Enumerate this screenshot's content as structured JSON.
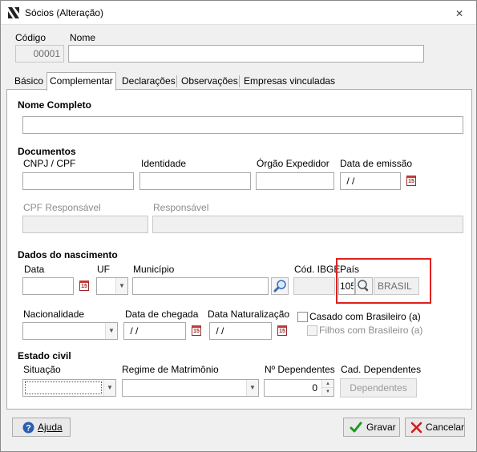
{
  "window": {
    "title": "Sócios (Alteração)"
  },
  "header": {
    "codigo_label": "Código",
    "codigo_value": "00001",
    "nome_label": "Nome",
    "nome_value": ""
  },
  "tabs": [
    {
      "label": "Básico",
      "active": false
    },
    {
      "label": "Complementar",
      "active": true
    },
    {
      "label": "Declarações",
      "active": false
    },
    {
      "label": "Observações",
      "active": false
    },
    {
      "label": "Empresas vinculadas",
      "active": false
    }
  ],
  "nome_completo": {
    "section": "Nome Completo",
    "value": ""
  },
  "documentos": {
    "section": "Documentos",
    "cnpj_label": "CNPJ / CPF",
    "cnpj_value": "",
    "identidade_label": "Identidade",
    "identidade_value": "",
    "orgao_label": "Órgão Expedidor",
    "orgao_value": "",
    "data_emissao_label": "Data de emissão",
    "data_emissao_value": " / /",
    "cpf_resp_label": "CPF Responsável",
    "cpf_resp_value": "",
    "responsavel_label": "Responsável",
    "responsavel_value": ""
  },
  "nascimento": {
    "section": "Dados do nascimento",
    "data_label": "Data",
    "data_value": "",
    "uf_label": "UF",
    "uf_value": "",
    "municipio_label": "Município",
    "municipio_value": "",
    "cod_ibge_label": "Cód. IBGE",
    "cod_ibge_value": "",
    "pais_label": "País",
    "pais_code": "105",
    "pais_name": "BRASIL",
    "nacionalidade_label": "Nacionalidade",
    "nacionalidade_value": "",
    "data_chegada_label": "Data de chegada",
    "data_chegada_value": " / /",
    "data_natur_label": "Data Naturalização",
    "data_natur_value": " / /",
    "casado_label": "Casado com Brasileiro (a)",
    "filhos_label": "Filhos com Brasileiro (a)"
  },
  "estado_civil": {
    "section": "Estado civil",
    "situacao_label": "Situação",
    "situacao_value": "",
    "regime_label": "Regime de Matrimônio",
    "regime_value": "",
    "dependentes_label": "Nº Dependentes",
    "dependentes_value": "0",
    "cad_dep_label": "Cad. Dependentes",
    "dependentes_button": "Dependentes"
  },
  "footer": {
    "ajuda": "Ajuda",
    "gravar": "Gravar",
    "cancelar": "Cancelar"
  },
  "colors": {
    "highlight": "#e02020",
    "help_icon": "#2a5fb0",
    "ok_icon": "#1e9a1e",
    "cancel_icon": "#d01818"
  }
}
